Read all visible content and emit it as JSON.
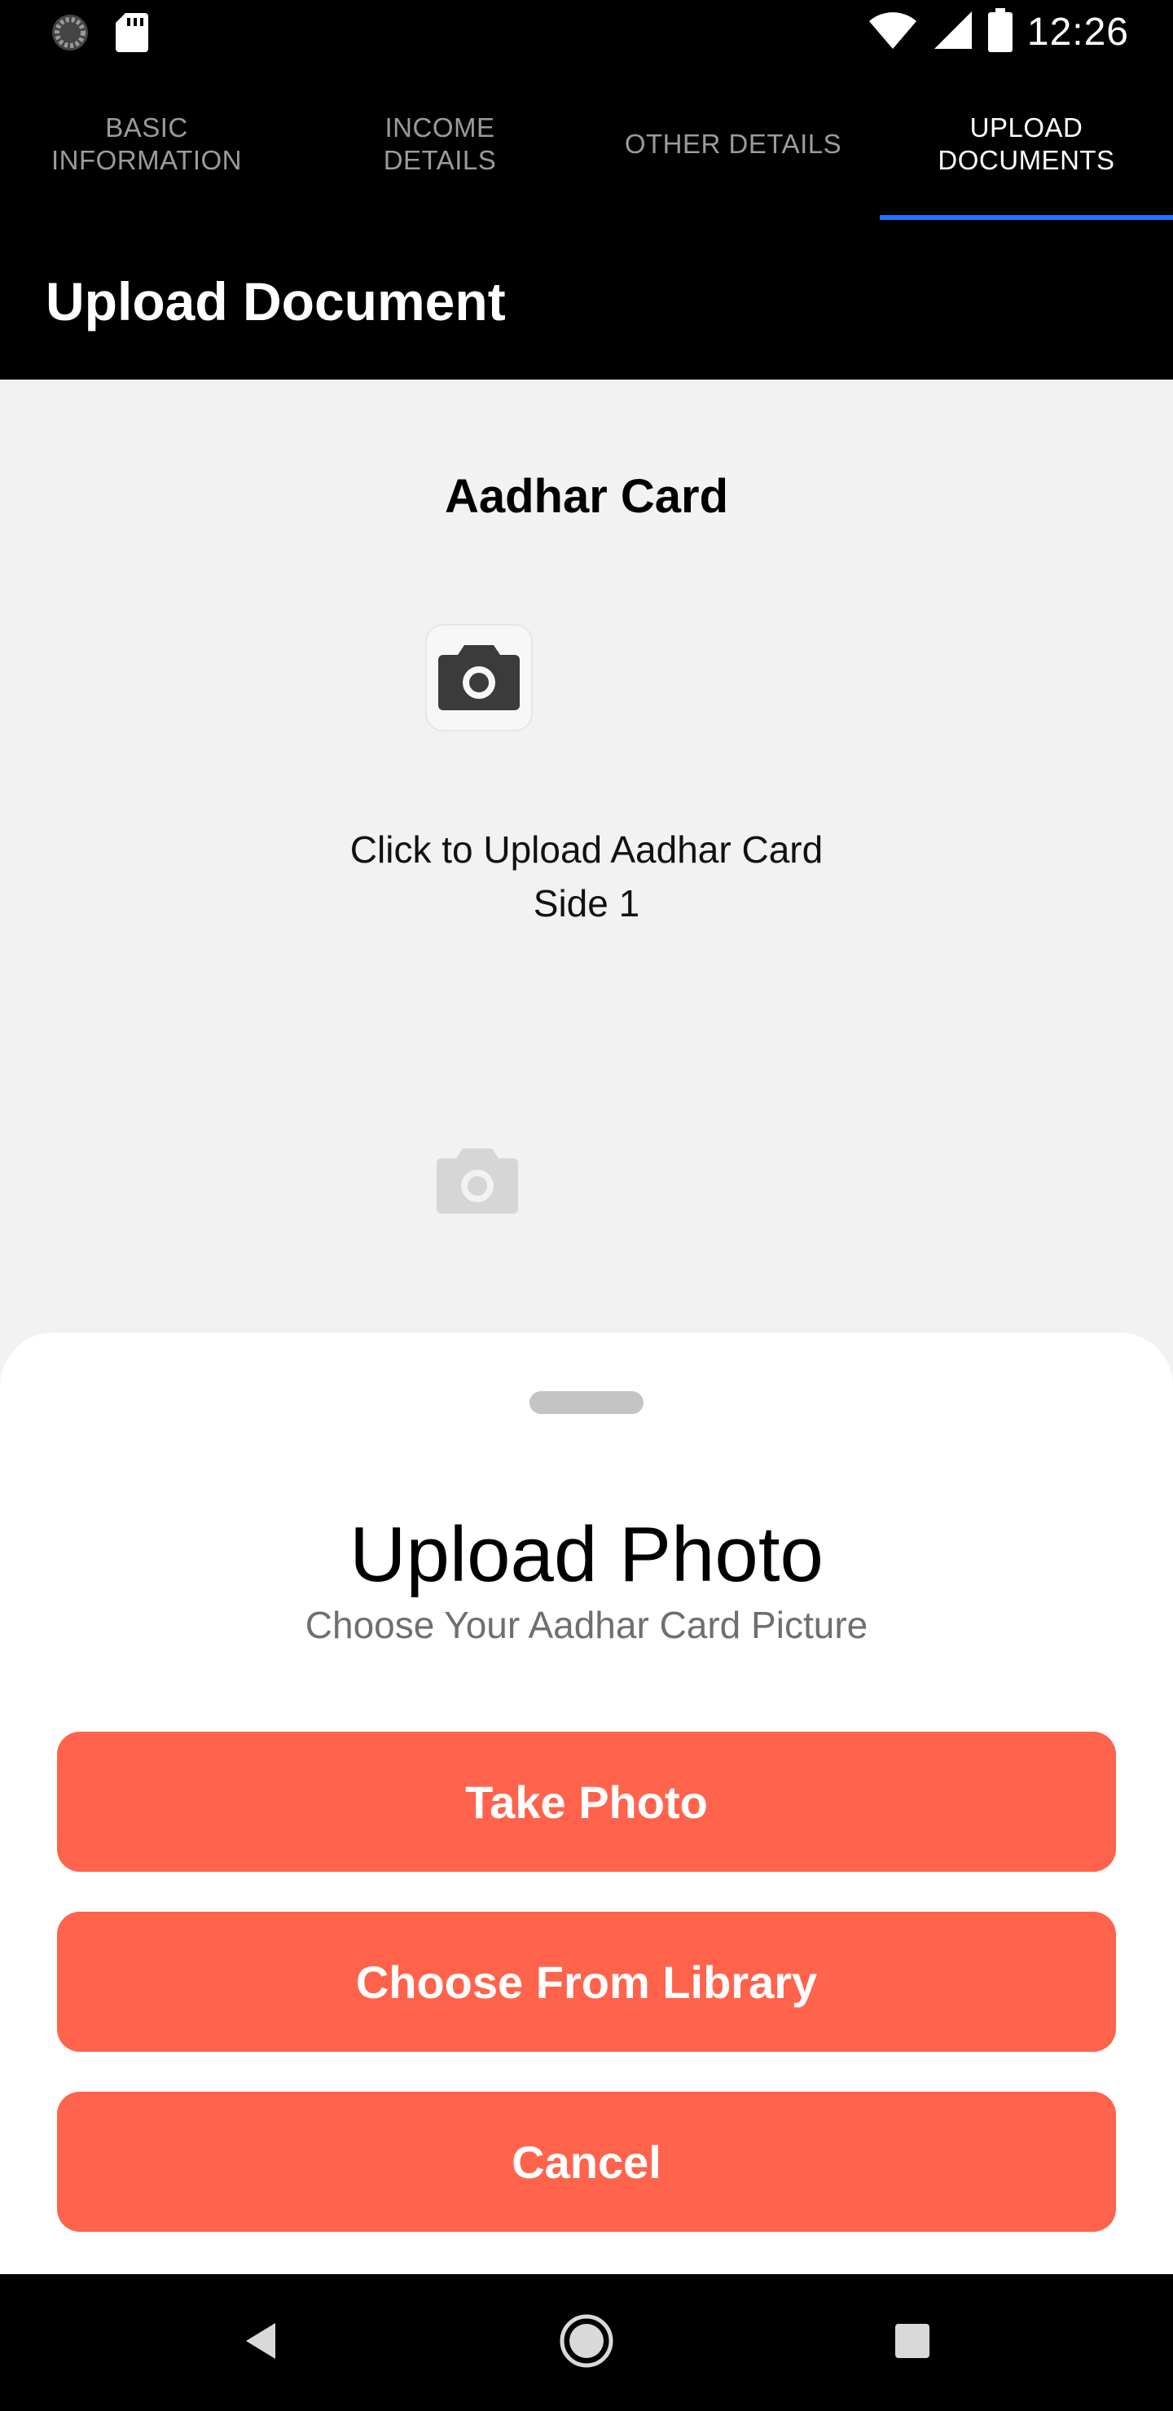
{
  "status_bar": {
    "time": "12:26",
    "icons": [
      "loading-icon",
      "sd-card-icon",
      "wifi-icon",
      "signal-icon",
      "battery-icon"
    ]
  },
  "tabs": [
    {
      "label": "BASIC\nINFORMATION",
      "active": false
    },
    {
      "label": "INCOME\nDETAILS",
      "active": false
    },
    {
      "label": "OTHER DETAILS",
      "active": false
    },
    {
      "label": "UPLOAD\nDOCUMENTS",
      "active": true
    }
  ],
  "header": {
    "title": "Upload Document"
  },
  "content": {
    "document_title": "Aadhar Card",
    "upload_label": "Click to Upload Aadhar Card\nSide 1"
  },
  "sheet": {
    "title": "Upload Photo",
    "subtitle": "Choose Your Aadhar Card Picture",
    "buttons": {
      "take_photo": "Take Photo",
      "choose_library": "Choose From Library",
      "cancel": "Cancel"
    }
  },
  "colors": {
    "accent": "#ff634c",
    "tab_indicator": "#1e76ff",
    "background": "#f2f2f2"
  },
  "nav_bar": {
    "icons": [
      "back-icon",
      "home-icon",
      "recents-icon"
    ]
  }
}
